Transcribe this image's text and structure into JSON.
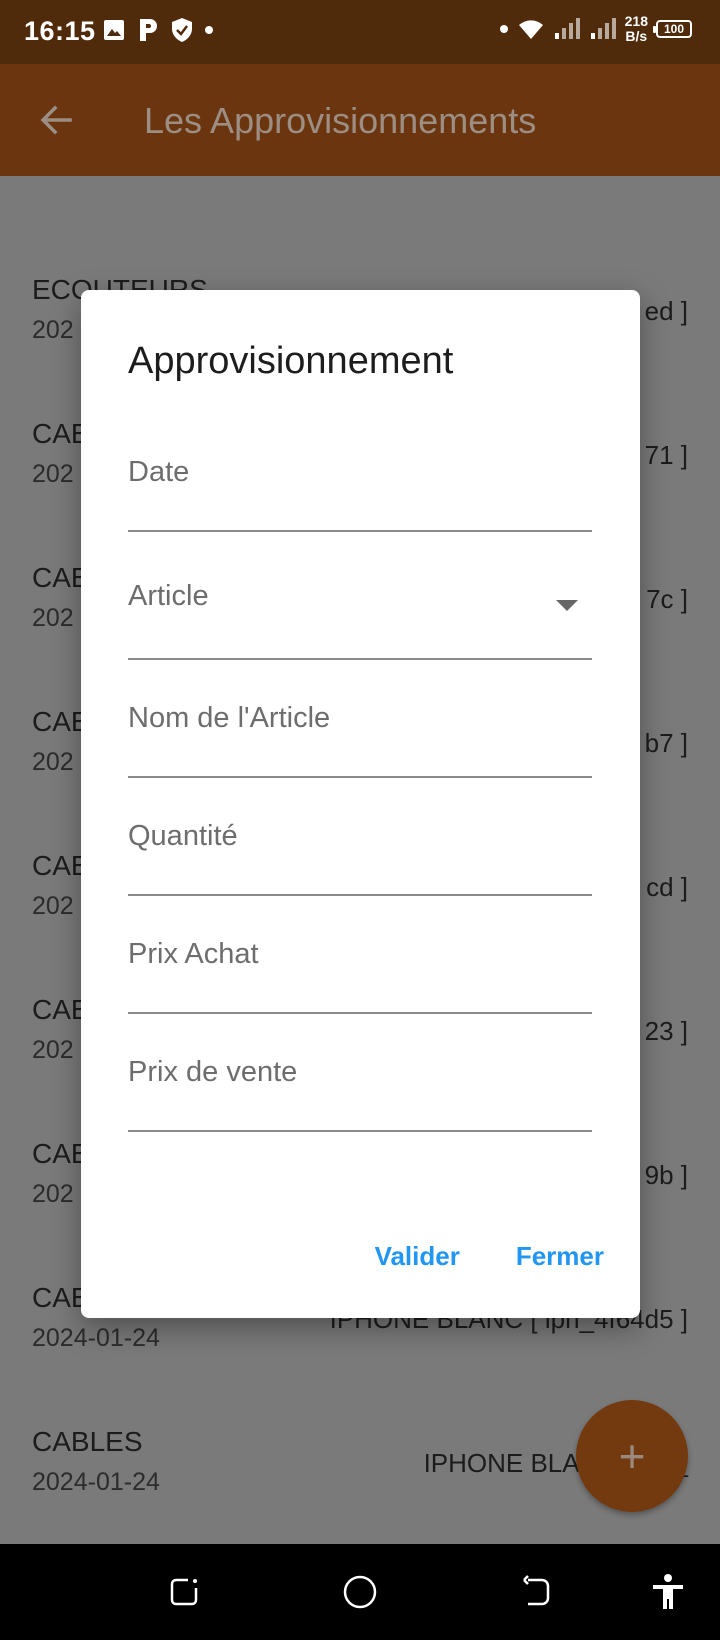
{
  "status_bar": {
    "time": "16:15",
    "speed_value": "218",
    "speed_unit": "B/s",
    "battery": "100"
  },
  "app_bar": {
    "title": "Les Approvisionnements",
    "back_icon": "arrow-left-icon"
  },
  "list": {
    "items": [
      {
        "category": "ECOUTEURS",
        "date": "202",
        "article": "ed ]"
      },
      {
        "category": "CAE",
        "date": "202",
        "article": "71 ]"
      },
      {
        "category": "CAE",
        "date": "202",
        "article": "7c ]"
      },
      {
        "category": "CAE",
        "date": "202",
        "article": "b7 ]"
      },
      {
        "category": "CAE",
        "date": "202",
        "article": "cd ]"
      },
      {
        "category": "CAE",
        "date": "202",
        "article": "23 ]"
      },
      {
        "category": "CAE",
        "date": "202",
        "article": "9b ]"
      },
      {
        "category": "CAE",
        "date": "2024-01-24",
        "article": "IPHONE BLANC [ iph_4f64d5 ]"
      },
      {
        "category": "CABLES",
        "date": "2024-01-24",
        "article": "IPHONE BLANC [ iph_"
      }
    ]
  },
  "fab": {
    "icon": "plus-icon",
    "label": "+"
  },
  "dialog": {
    "title": "Approvisionnement",
    "fields": {
      "date": "Date",
      "article": "Article",
      "nom_article": "Nom de l'Article",
      "quantite": "Quantité",
      "prix_achat": "Prix Achat",
      "prix_vente": "Prix de vente"
    },
    "actions": {
      "valider": "Valider",
      "fermer": "Fermer"
    }
  },
  "colors": {
    "status_bar": "#4f2a0b",
    "app_bar_dimmed": "#6b3510",
    "accent": "#2196f3",
    "scrim_background": "#7a7a7a"
  }
}
